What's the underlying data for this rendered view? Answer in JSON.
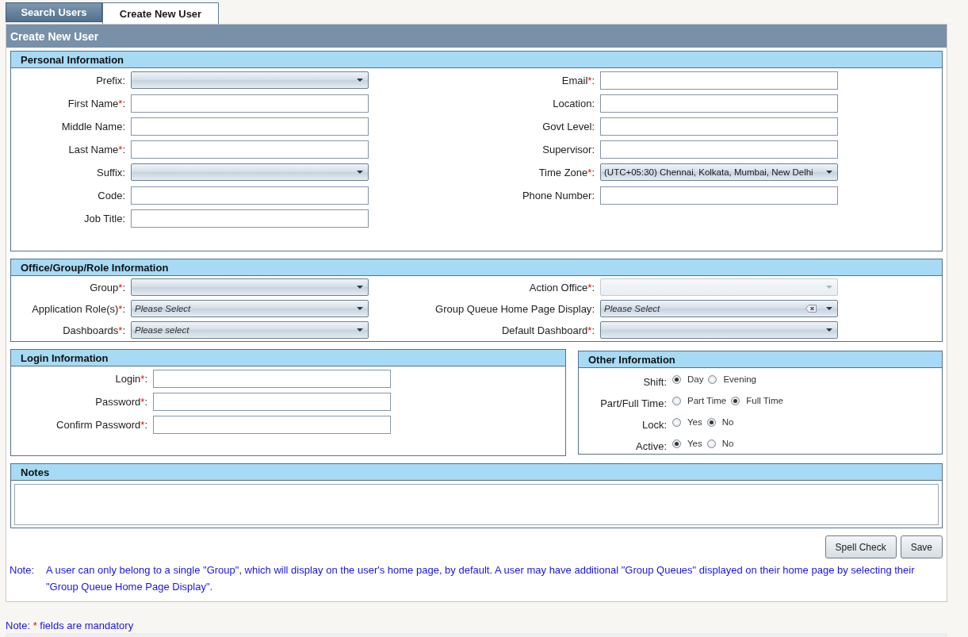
{
  "tabs": [
    {
      "label": "Search Users",
      "selected": false
    },
    {
      "label": "Create New User",
      "selected": true
    }
  ],
  "panel_title": "Create New User",
  "required_mark": "*",
  "label_end": ":",
  "personal": {
    "title": "Personal Information",
    "left": [
      {
        "label": "Prefix",
        "kind": "select"
      },
      {
        "label": "First Name",
        "required": true,
        "kind": "text"
      },
      {
        "label": "Middle Name",
        "kind": "text"
      },
      {
        "label": "Last Name",
        "required": true,
        "kind": "text"
      },
      {
        "label": "Suffix",
        "kind": "select"
      },
      {
        "label": "Code",
        "kind": "text"
      },
      {
        "label": "Job Title",
        "kind": "text"
      }
    ],
    "right": [
      {
        "label": "Email",
        "required": true,
        "kind": "text"
      },
      {
        "label": "Location",
        "kind": "text"
      },
      {
        "label": "Govt Level",
        "kind": "text"
      },
      {
        "label": "Supervisor",
        "kind": "text"
      },
      {
        "label": "Time Zone",
        "required": true,
        "kind": "select",
        "value": "(UTC+05:30) Chennai, Kolkata, Mumbai, New Delhi"
      },
      {
        "label": "Phone Number",
        "kind": "text"
      }
    ]
  },
  "office": {
    "title": "Office/Group/Role Information",
    "left": [
      {
        "label": "Group",
        "required": true,
        "kind": "select"
      },
      {
        "label": "Application Role(s)",
        "required": true,
        "kind": "select",
        "placeholder": "Please Select"
      },
      {
        "label": "Dashboards",
        "required": true,
        "kind": "select",
        "placeholder": "Please select"
      }
    ],
    "right": [
      {
        "label": "Action Office",
        "required": true,
        "kind": "select",
        "disabled": true
      },
      {
        "label": "Group Queue Home Page Display",
        "kind": "select",
        "placeholder": "Please Select",
        "clearable": true
      },
      {
        "label": "Default Dashboard",
        "required": true,
        "kind": "select"
      }
    ]
  },
  "login": {
    "title": "Login Information",
    "fields": [
      {
        "label": "Login",
        "required": true
      },
      {
        "label": "Password",
        "required": true
      },
      {
        "label": "Confirm Password",
        "required": true
      }
    ]
  },
  "other": {
    "title": "Other Information",
    "groups": [
      {
        "label": "Shift",
        "options": [
          {
            "label": "Day",
            "selected": true
          },
          {
            "label": "Evening",
            "selected": false
          }
        ]
      },
      {
        "label": "Part/Full Time",
        "options": [
          {
            "label": "Part Time",
            "selected": false
          },
          {
            "label": "Full Time",
            "selected": true
          }
        ]
      },
      {
        "label": "Lock",
        "options": [
          {
            "label": "Yes",
            "selected": false
          },
          {
            "label": "No",
            "selected": true
          }
        ]
      },
      {
        "label": "Active",
        "options": [
          {
            "label": "Yes",
            "selected": true
          },
          {
            "label": "No",
            "selected": false
          }
        ]
      }
    ]
  },
  "notes": {
    "title": "Notes"
  },
  "buttons": [
    "Spell Check",
    "Save"
  ],
  "note": {
    "label": "Note:",
    "text": "A user can only belong to a single \"Group\", which will display on the user's home page, by default. A user may have additional \"Group Queues\" displayed on their home page by selecting their \"Group Queue Home Page Display\"."
  },
  "mandatory_note": {
    "label": "Note:",
    "mark": "*",
    "text": "fields are mandatory"
  }
}
